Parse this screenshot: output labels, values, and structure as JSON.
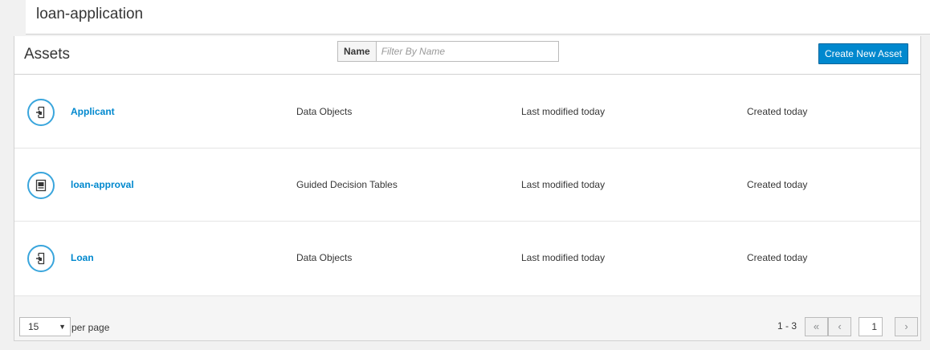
{
  "project": {
    "title": "loan-application"
  },
  "assets_panel": {
    "title": "Assets",
    "filter": {
      "label": "Name",
      "placeholder": "Filter By Name",
      "value": ""
    },
    "create_button": "Create New Asset"
  },
  "assets": [
    {
      "name": "Applicant",
      "type": "Data Objects",
      "modified": "Last modified today",
      "created": "Created today",
      "icon": "data-object-icon"
    },
    {
      "name": "loan-approval",
      "type": "Guided Decision Tables",
      "modified": "Last modified today",
      "created": "Created today",
      "icon": "decision-table-icon"
    },
    {
      "name": "Loan",
      "type": "Data Objects",
      "modified": "Last modified today",
      "created": "Created today",
      "icon": "data-object-icon"
    }
  ],
  "pagination": {
    "per_page_value": "15",
    "per_page_label": "per page",
    "range": "1 - 3",
    "current_page": "1"
  },
  "colors": {
    "accent": "#0088ce",
    "icon_ring": "#39a5dc"
  }
}
